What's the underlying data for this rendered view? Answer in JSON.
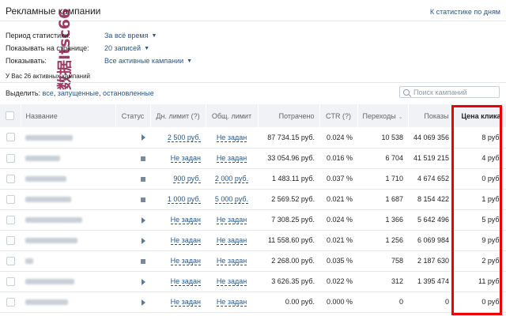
{
  "page": {
    "title": "Рекламные кампании",
    "stats_link": "К статистике по дням"
  },
  "filters": [
    {
      "label": "Период статистики:",
      "value": "За всё время"
    },
    {
      "label": "Показывать на странице:",
      "value": "20 записей"
    },
    {
      "label": "Показывать:",
      "value": "Все активные кампании"
    }
  ],
  "campaign_count": "У Вас 26 активных кампаний",
  "show_filter": {
    "prefix": "Выделить:",
    "options": [
      "все",
      "запущенные",
      "остановленные"
    ]
  },
  "search": {
    "placeholder": "Поиск кампаний"
  },
  "watermark_text": "数据Itsc66",
  "table": {
    "headers": {
      "name": "Название",
      "status": "Статус",
      "day_limit": "Дн. лимит (?)",
      "total_limit": "Общ. лимит",
      "spent": "Потрачено",
      "ctr": "CTR (?)",
      "clicks": "Переходы",
      "impressions": "Показы",
      "price": "Цена клика"
    },
    "rows": [
      {
        "status": "play",
        "day_limit": "2 500 руб.",
        "total_limit": "Не задан",
        "spent": "87 734.15 руб.",
        "ctr": "0.024 %",
        "clicks": "10 538",
        "impressions": "44 069 356",
        "price": "8 руб."
      },
      {
        "status": "stop",
        "day_limit": "Не задан",
        "total_limit": "Не задан",
        "spent": "33 054.96 руб.",
        "ctr": "0.016 %",
        "clicks": "6 704",
        "impressions": "41 519 215",
        "price": "4 руб."
      },
      {
        "status": "stop",
        "day_limit": "900 руб.",
        "total_limit": "2 000 руб.",
        "spent": "1 483.11 руб.",
        "ctr": "0.037 %",
        "clicks": "1 710",
        "impressions": "4 674 652",
        "price": "0 руб."
      },
      {
        "status": "stop",
        "day_limit": "1 000 руб.",
        "total_limit": "5 000 руб.",
        "spent": "2 569.52 руб.",
        "ctr": "0.021 %",
        "clicks": "1 687",
        "impressions": "8 154 422",
        "price": "1 руб."
      },
      {
        "status": "play",
        "day_limit": "Не задан",
        "total_limit": "Не задан",
        "spent": "7 308.25 руб.",
        "ctr": "0.024 %",
        "clicks": "1 366",
        "impressions": "5 642 496",
        "price": "5 руб."
      },
      {
        "status": "play",
        "day_limit": "Не задан",
        "total_limit": "Не задан",
        "spent": "11 558.60 руб.",
        "ctr": "0.021 %",
        "clicks": "1 256",
        "impressions": "6 069 984",
        "price": "9 руб."
      },
      {
        "status": "stop",
        "day_limit": "Не задан",
        "total_limit": "Не задан",
        "spent": "2 268.00 руб.",
        "ctr": "0.035 %",
        "clicks": "758",
        "impressions": "2 187 630",
        "price": "2 руб."
      },
      {
        "status": "play",
        "day_limit": "Не задан",
        "total_limit": "Не задан",
        "spent": "3 626.35 руб.",
        "ctr": "0.022 %",
        "clicks": "312",
        "impressions": "1 395 474",
        "price": "11 руб."
      },
      {
        "status": "play",
        "day_limit": "Не задан",
        "total_limit": "Не задан",
        "spent": "0.00 руб.",
        "ctr": "0.000 %",
        "clicks": "0",
        "impressions": "0",
        "price": "0 руб."
      }
    ]
  },
  "colors": {
    "link": "#2a5885",
    "highlight": "#ee0000",
    "header_bg": "#f0f2f5"
  }
}
